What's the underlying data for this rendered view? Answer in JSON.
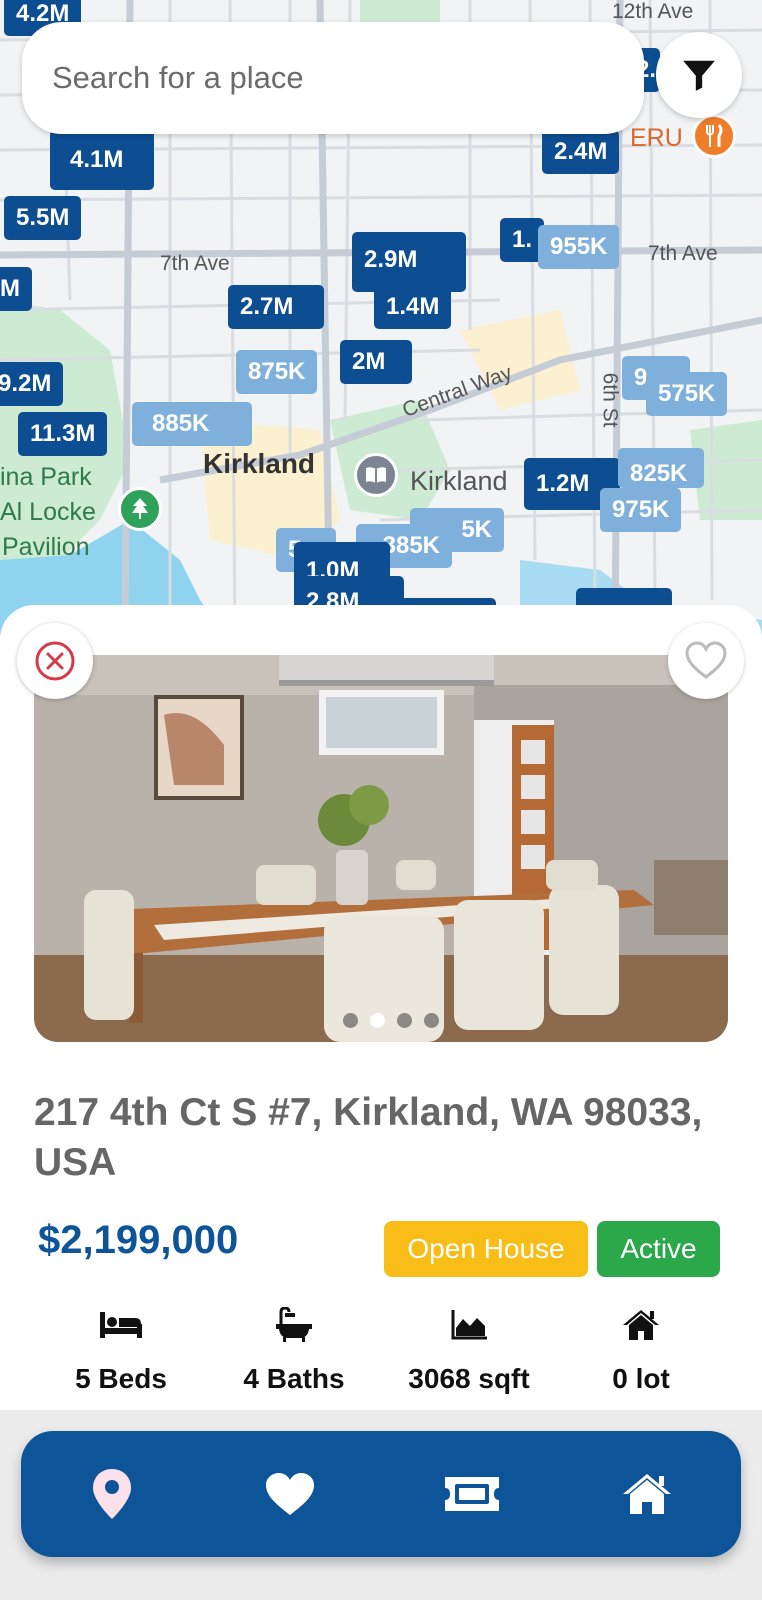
{
  "search": {
    "placeholder": "Search for a place"
  },
  "map": {
    "streets": [
      "12th Ave",
      "7th Ave",
      "7th Ave",
      "Central Way",
      "6th St"
    ],
    "city": "Kirkland",
    "places": [
      "Kirkland",
      "ina Park",
      "Al Locke",
      "Pavilion",
      "ERU"
    ],
    "price_pins": [
      "4.2M",
      "4.1M",
      "5.5M",
      "M",
      "2.9M",
      "1.4M",
      "2.7M",
      "2.4M",
      "2M",
      "875K",
      "9.2M",
      "11.3M",
      "885K",
      "2.4M",
      "1.",
      "955K",
      "9",
      "575K",
      "1.2M",
      "825K",
      "975K",
      "5K",
      "385K",
      "5",
      "1.0M",
      "2.8M"
    ]
  },
  "listing": {
    "address": "217 4th Ct S #7, Kirkland, WA 98033, USA",
    "price": "$2,199,000",
    "badges": {
      "open_house": "Open House",
      "status": "Active"
    },
    "stats": [
      {
        "icon": "bed-icon",
        "value": "5 Beds"
      },
      {
        "icon": "bathtub-icon",
        "value": "4 Baths"
      },
      {
        "icon": "area-chart-icon",
        "value": "3068 sqft"
      },
      {
        "icon": "house-icon",
        "value": "0 lot"
      }
    ],
    "photo_count": 4,
    "photo_index": 1
  },
  "nav": {
    "items": [
      "map-pin-icon",
      "heart-icon",
      "ticket-icon",
      "home-icon"
    ]
  },
  "colors": {
    "brand_blue": "#0d5498",
    "pin_dark": "#0d4e93",
    "pin_light": "#7fb0dc",
    "open_house": "#f8bd16",
    "active": "#2aa84a",
    "close_red": "#d53a4a"
  }
}
